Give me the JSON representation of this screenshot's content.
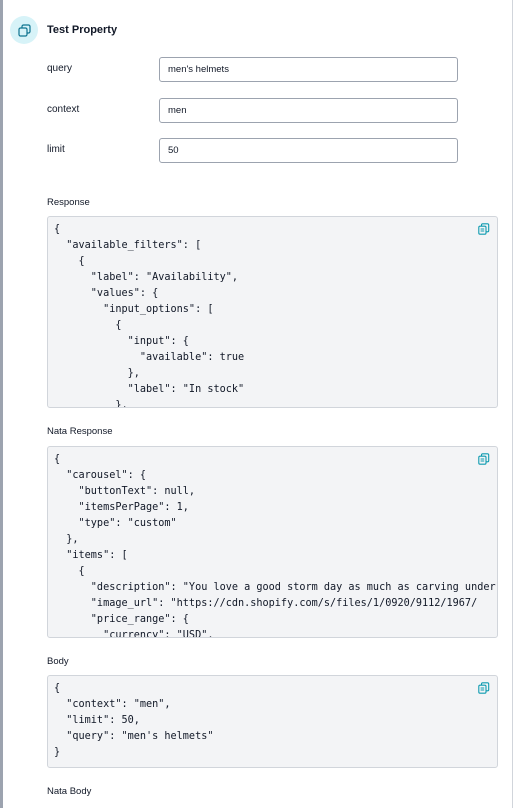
{
  "header": {
    "title": "Test Property",
    "icon": "copy-icon"
  },
  "fields": [
    {
      "label": "query",
      "value": "men's helmets"
    },
    {
      "label": "context",
      "value": "men"
    },
    {
      "label": "limit",
      "value": "50"
    }
  ],
  "response": {
    "label": "Response",
    "code": "{\n  \"available_filters\": [\n    {\n      \"label\": \"Availability\",\n      \"values\": {\n        \"input_options\": [\n          {\n            \"input\": {\n              \"available\": true\n            },\n            \"label\": \"In stock\"\n          },"
  },
  "nata_response": {
    "label": "Nata Response",
    "code": "{\n  \"carousel\": {\n    \"buttonText\": null,\n    \"itemsPerPage\": 1,\n    \"type\": \"custom\"\n  },\n  \"items\": [\n    {\n      \"description\": \"You love a good storm day as much as carving under\n      \"image_url\": \"https://cdn.shopify.com/s/files/1/0920/9112/1967/\n      \"price_range\": {\n        \"currency\": \"USD\","
  },
  "body": {
    "label": "Body",
    "code": "{\n  \"context\": \"men\",\n  \"limit\": 50,\n  \"query\": \"men's helmets\"\n}"
  },
  "nata_body": {
    "label": "Nata Body"
  },
  "colors": {
    "accent": "#0ea5b7",
    "icon_bg": "#d7f3f8",
    "code_bg": "#f3f4f6"
  }
}
